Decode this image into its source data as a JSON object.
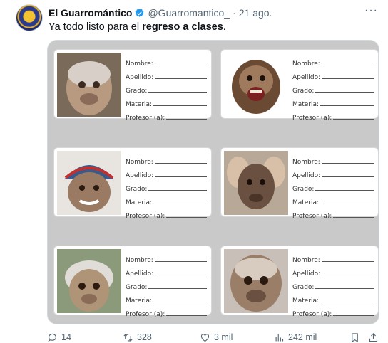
{
  "author": {
    "name": "El Guarromántico",
    "handle": "@Guarromantico_",
    "separator": "·",
    "date": "21 ago.",
    "verified_icon": "verified-badge-icon",
    "verified_color": "#1d9bf0"
  },
  "more_label": "···",
  "tweet": {
    "text_prefix": "Ya todo listo para el ",
    "text_bold": "regreso a clases",
    "text_suffix": "."
  },
  "media": {
    "cards": [
      {
        "photo": "monkey-photo-1",
        "fields": [
          "Nombre:",
          "Apellido:",
          "Grado:",
          "Materia:",
          "Profesor (a):"
        ]
      },
      {
        "photo": "monkey-photo-2",
        "fields": [
          "Nombre:",
          "Apellido:",
          "Grado:",
          "Materia:",
          "Profesor (a):"
        ]
      },
      {
        "photo": "monkey-photo-3",
        "fields": [
          "Nombre:",
          "Apellido:",
          "Grado:",
          "Materia:",
          "Profesor (a):"
        ]
      },
      {
        "photo": "monkey-photo-4",
        "fields": [
          "Nombre:",
          "Apellido:",
          "Grado:",
          "Materia:",
          "Profesor (a):"
        ]
      },
      {
        "photo": "monkey-photo-5",
        "fields": [
          "Nombre:",
          "Apellido:",
          "Grado:",
          "Materia:",
          "Profesor (a):"
        ]
      },
      {
        "photo": "monkey-photo-6",
        "fields": [
          "Nombre:",
          "Apellido:",
          "Grado:",
          "Materia:",
          "Profesor (a):"
        ]
      }
    ]
  },
  "actions": {
    "replies": "14",
    "reposts": "328",
    "likes": "3 mil",
    "views": "242 mil"
  }
}
